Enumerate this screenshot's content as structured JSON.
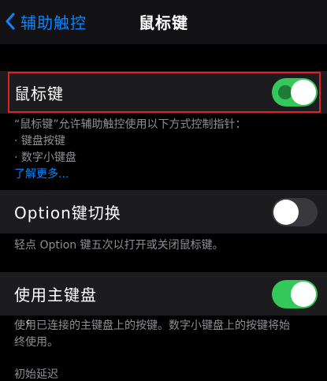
{
  "nav": {
    "back_label": "辅助触控",
    "title": "鼠标键"
  },
  "mouse_keys": {
    "label": "鼠标键",
    "toggle_on": true
  },
  "mouse_keys_note": {
    "intro": "“鼠标键”允许辅助触控使用以下方式控制指针：",
    "bullets": [
      "· 键盘按键",
      "· 数字小键盘"
    ],
    "link": "了解更多..."
  },
  "option_toggle": {
    "label": "Option键切换",
    "toggle_on": false
  },
  "option_note": "轻点 Option 键五次以打开或关闭鼠标键。",
  "main_keyboard": {
    "label": "使用主键盘",
    "toggle_on": true
  },
  "main_keyboard_note": {
    "line1": "使用已连接的主键盘上的按键。数字小键盘上的按键将始",
    "line2": "终使用。"
  },
  "initial_delay_label": "初始延迟",
  "colors": {
    "accent": "#0a84ff",
    "toggle_on": "#34c759",
    "highlight": "#e0202a"
  }
}
